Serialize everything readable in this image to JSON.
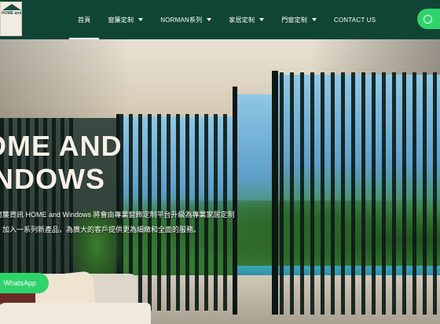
{
  "brand": {
    "logo_text": "HOME and WINDOWS"
  },
  "nav": {
    "items": [
      {
        "label": "首頁",
        "dropdown": false,
        "active": true
      },
      {
        "label": "窗簾定制",
        "dropdown": true,
        "active": false
      },
      {
        "label": "NORMAN系列",
        "dropdown": true,
        "active": false
      },
      {
        "label": "家居定制",
        "dropdown": true,
        "active": false
      },
      {
        "label": "門窗定制",
        "dropdown": true,
        "active": false
      },
      {
        "label": "CONTACT US",
        "dropdown": false,
        "active": false
      }
    ]
  },
  "header_whatsapp": {
    "icon": "whatsapp-icon",
    "color": "#2fd36b"
  },
  "hero": {
    "title_line1": "OME AND",
    "title_line2": "INDOWS",
    "desc_line1": "窗簾資訊 HOME and Windows 將會由專業窗飾定制平台升級為專業家居定制",
    "desc_line2": "，加入一系列新產品，為廣大的客戶提供更為細緻和全面的服務。",
    "whatsapp_label": "WhatsApp"
  },
  "colors": {
    "header_bg": "#104536",
    "accent_green": "#2fd36b",
    "hero_text": "#f7f2e7"
  }
}
